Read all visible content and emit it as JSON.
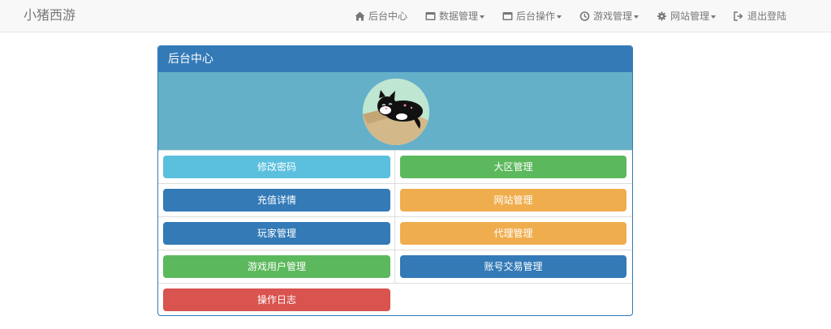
{
  "brand": "小猪西游",
  "nav": [
    {
      "label": "后台中心",
      "icon": "home-icon",
      "dropdown": false
    },
    {
      "label": "数据管理",
      "icon": "window-icon",
      "dropdown": true
    },
    {
      "label": "后台操作",
      "icon": "window-icon",
      "dropdown": true
    },
    {
      "label": "游戏管理",
      "icon": "clock-icon",
      "dropdown": true
    },
    {
      "label": "网站管理",
      "icon": "gear-icon",
      "dropdown": true
    },
    {
      "label": "退出登陆",
      "icon": "logout-icon",
      "dropdown": false
    }
  ],
  "panel": {
    "title": "后台中心",
    "avatar": "cat-avatar-image",
    "buttons": [
      {
        "label": "修改密码",
        "color": "#5bc0de"
      },
      {
        "label": "大区管理",
        "color": "#5cb85c"
      },
      {
        "label": "充值详情",
        "color": "#337ab7"
      },
      {
        "label": "网站管理",
        "color": "#f0ad4e"
      },
      {
        "label": "玩家管理",
        "color": "#337ab7"
      },
      {
        "label": "代理管理",
        "color": "#f0ad4e"
      },
      {
        "label": "游戏用户管理",
        "color": "#5cb85c"
      },
      {
        "label": "账号交易管理",
        "color": "#337ab7"
      },
      {
        "label": "操作日志",
        "color": "#d9534f"
      }
    ]
  },
  "colors": {
    "primary": "#337ab7",
    "info": "#5bc0de",
    "success": "#5cb85c",
    "warning": "#f0ad4e",
    "danger": "#d9534f",
    "avatar_bg": "#64b0c9"
  }
}
